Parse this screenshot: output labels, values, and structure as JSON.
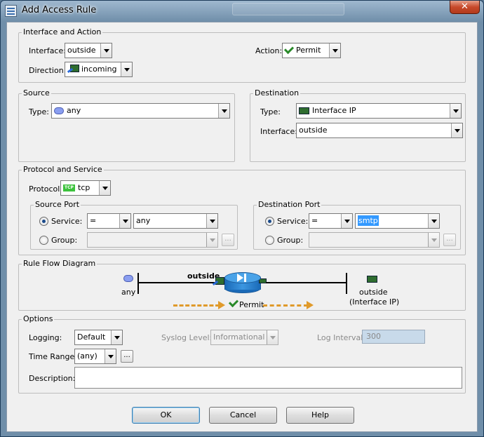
{
  "window": {
    "title": "Add Access Rule",
    "close": "✕"
  },
  "interface_action": {
    "title": "Interface and Action",
    "interface_label": "Interface:",
    "interface_value": "outside",
    "direction_label": "Direction:",
    "direction_value": "incoming",
    "action_label": "Action:",
    "action_value": "Permit"
  },
  "source": {
    "title": "Source",
    "type_label": "Type:",
    "type_value": "any"
  },
  "destination": {
    "title": "Destination",
    "type_label": "Type:",
    "type_value": "Interface IP",
    "interface_label": "Interface:",
    "interface_value": "outside"
  },
  "protocol_service": {
    "title": "Protocol and Service",
    "protocol_label": "Protocol:",
    "protocol_value": "tcp",
    "source_port": {
      "title": "Source Port",
      "service_label": "Service:",
      "operator": "=",
      "service_value": "any",
      "group_label": "Group:",
      "browse": "..."
    },
    "destination_port": {
      "title": "Destination Port",
      "service_label": "Service:",
      "operator": "=",
      "service_value": "smtp",
      "group_label": "Group:",
      "browse": "..."
    }
  },
  "rule_flow": {
    "title": "Rule Flow Diagram",
    "source_label": "any",
    "interface_label": "outside",
    "dest_label": "outside",
    "dest_sub": "(Interface IP)",
    "action_label": "Permit"
  },
  "options": {
    "title": "Options",
    "logging_label": "Logging:",
    "logging_value": "Default",
    "syslog_label": "Syslog Level:",
    "syslog_value": "Informational",
    "interval_label": "Log Interval:",
    "interval_value": "300",
    "time_range_label": "Time Range:",
    "time_range_value": "(any)",
    "time_range_browse": "...",
    "description_label": "Description:",
    "description_value": ""
  },
  "buttons": {
    "ok": "OK",
    "cancel": "Cancel",
    "help": "Help"
  }
}
